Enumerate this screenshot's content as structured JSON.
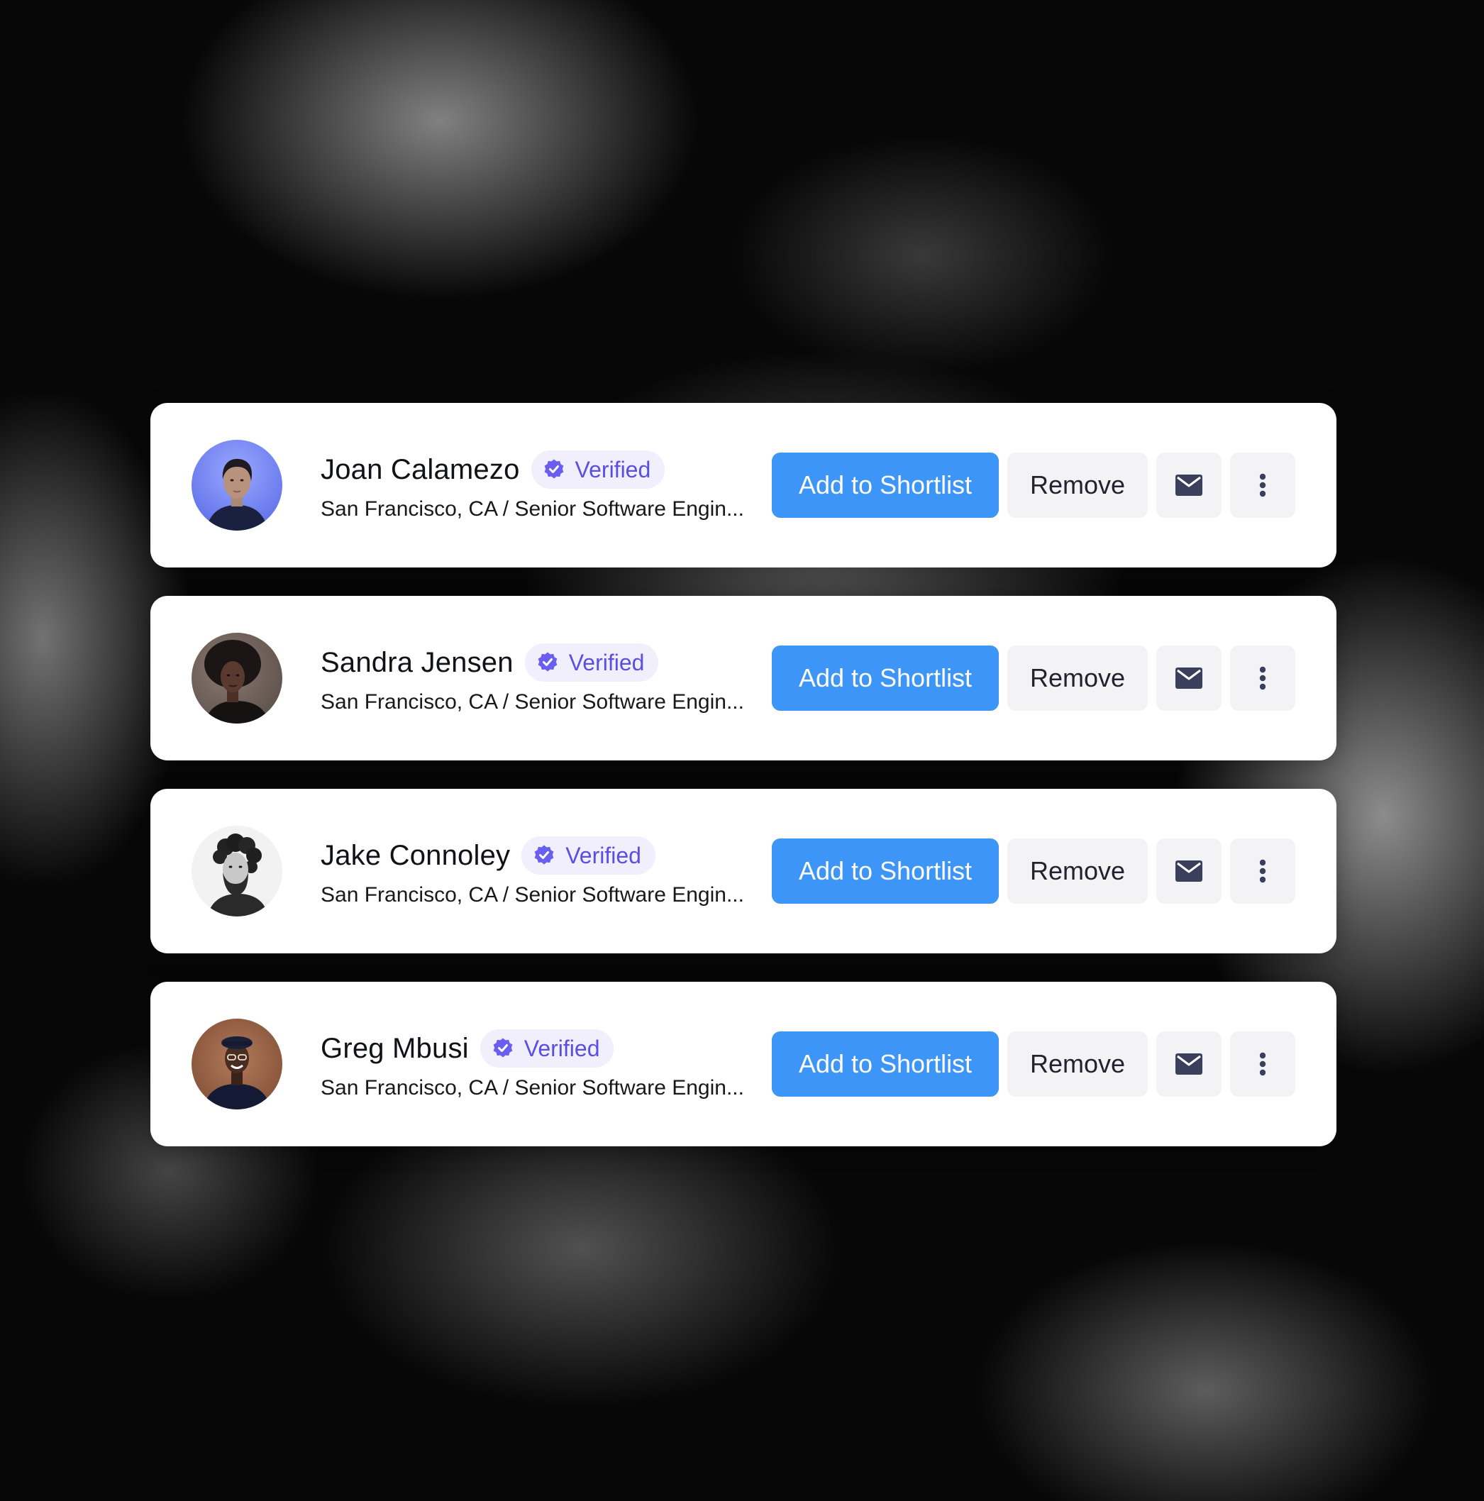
{
  "colors": {
    "primary_button": "#3d95f7",
    "secondary_button": "#f3f3f6",
    "badge_background": "#f1effc",
    "badge_accent": "#5a4fe0",
    "icon": "#3a3f5c"
  },
  "candidates": [
    {
      "name": "Joan Calamezo",
      "badge": "Verified",
      "subtitle": "San Francisco, CA / Senior Software Engin...",
      "avatar": "portrait-photo",
      "primary_action": "Add to Shortlist",
      "secondary_action": "Remove",
      "icon_actions": [
        "mail-icon",
        "more-vertical-icon"
      ]
    },
    {
      "name": "Sandra Jensen",
      "badge": "Verified",
      "subtitle": "San Francisco, CA / Senior Software Engin...",
      "avatar": "portrait-photo",
      "primary_action": "Add to Shortlist",
      "secondary_action": "Remove",
      "icon_actions": [
        "mail-icon",
        "more-vertical-icon"
      ]
    },
    {
      "name": "Jake Connoley",
      "badge": "Verified",
      "subtitle": "San Francisco, CA / Senior Software Engin...",
      "avatar": "portrait-photo",
      "primary_action": "Add to Shortlist",
      "secondary_action": "Remove",
      "icon_actions": [
        "mail-icon",
        "more-vertical-icon"
      ]
    },
    {
      "name": "Greg Mbusi",
      "badge": "Verified",
      "subtitle": "San Francisco, CA / Senior Software Engin...",
      "avatar": "portrait-photo",
      "primary_action": "Add to Shortlist",
      "secondary_action": "Remove",
      "icon_actions": [
        "mail-icon",
        "more-vertical-icon"
      ]
    }
  ]
}
